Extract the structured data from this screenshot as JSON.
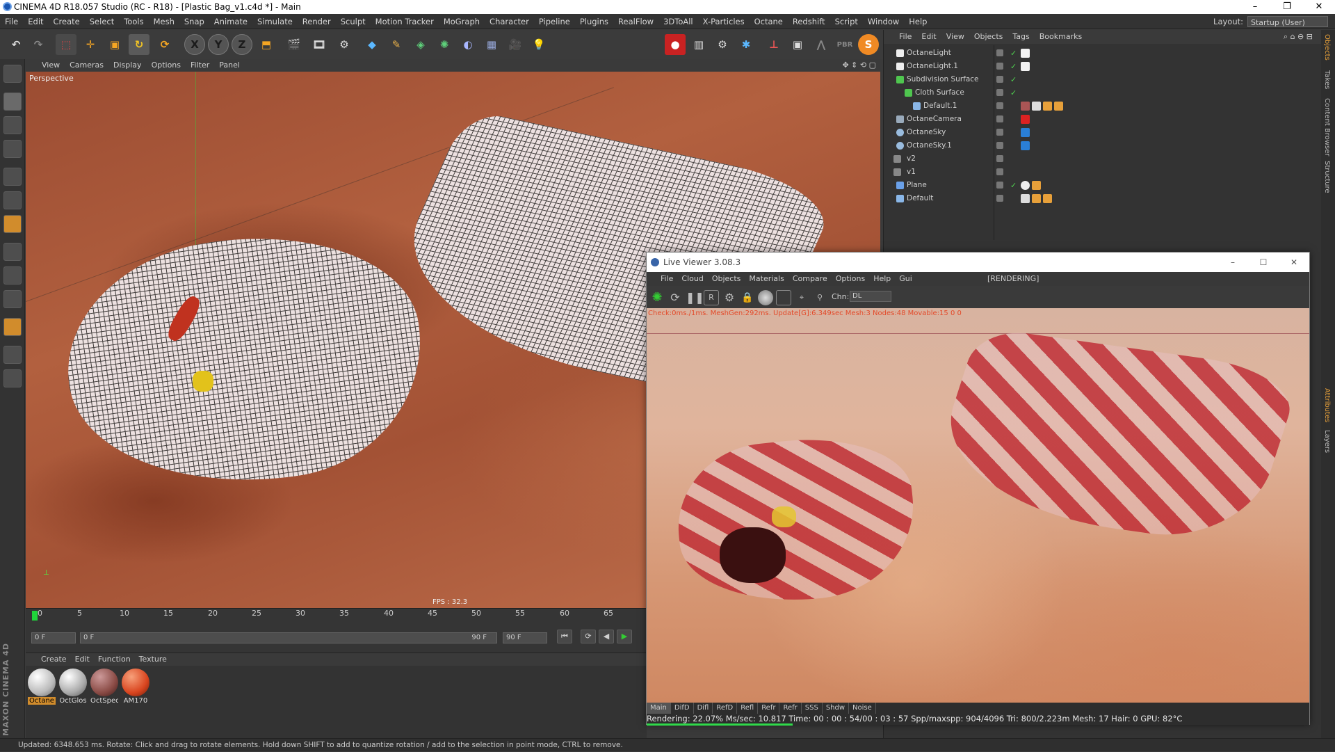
{
  "window": {
    "title": "CINEMA 4D R18.057 Studio (RC - R18) - [Plastic Bag_v1.c4d *] - Main"
  },
  "menubar": {
    "items": [
      "File",
      "Edit",
      "Create",
      "Select",
      "Tools",
      "Mesh",
      "Snap",
      "Animate",
      "Simulate",
      "Render",
      "Sculpt",
      "Motion Tracker",
      "MoGraph",
      "Character",
      "Pipeline",
      "Plugins",
      "RealFlow",
      "3DToAll",
      "X-Particles",
      "Octane",
      "Redshift",
      "Script",
      "Window",
      "Help"
    ],
    "layout_label": "Layout:",
    "layout_value": "Startup (User)"
  },
  "viewport": {
    "menu": [
      "View",
      "Cameras",
      "Display",
      "Options",
      "Filter",
      "Panel"
    ],
    "label": "Perspective",
    "fps": "FPS : 32.3"
  },
  "timeline": {
    "ticks": [
      "0",
      "5",
      "10",
      "15",
      "20",
      "25",
      "30",
      "35",
      "40",
      "45",
      "50",
      "55",
      "60",
      "65"
    ],
    "start_field": "0 F",
    "range_start": "0 F",
    "range_end": "90 F",
    "end_field": "90 F"
  },
  "materials": {
    "menu": [
      "Create",
      "Edit",
      "Function",
      "Texture"
    ],
    "items": [
      {
        "label": "Octane",
        "color": "#e8e8e8"
      },
      {
        "label": "OctGlos",
        "color": "#dcdcdc"
      },
      {
        "label": "OctSpec",
        "color": "#8a4b45"
      },
      {
        "label": "AM170",
        "color": "#d9451f"
      }
    ]
  },
  "status": {
    "text": "Updated: 6348.653 ms.    Rotate: Click and drag to rotate elements. Hold down SHIFT to add to quantize rotation / add to the selection in point mode, CTRL to remove."
  },
  "objects": {
    "menu": [
      "File",
      "Edit",
      "View",
      "Objects",
      "Tags",
      "Bookmarks"
    ],
    "rows": [
      {
        "name": "OctaneLight"
      },
      {
        "name": "OctaneLight.1"
      },
      {
        "name": "Subdivision Surface"
      },
      {
        "name": "Cloth Surface"
      },
      {
        "name": "Default.1"
      },
      {
        "name": "OctaneCamera"
      },
      {
        "name": "OctaneSky"
      },
      {
        "name": "OctaneSky.1"
      },
      {
        "name": "v2"
      },
      {
        "name": "v1"
      },
      {
        "name": "Plane"
      },
      {
        "name": "Default"
      }
    ],
    "side_tabs": [
      "Objects",
      "Takes",
      "Content Browser",
      "Structure"
    ],
    "side_tabs_lower": [
      "Attributes",
      "Layers"
    ]
  },
  "liveviewer": {
    "title": "Live Viewer 3.08.3",
    "menu": [
      "File",
      "Cloud",
      "Objects",
      "Materials",
      "Compare",
      "Options",
      "Help",
      "Gui"
    ],
    "status": "[RENDERING]",
    "chn_label": "Chn:",
    "chn_value": "DL",
    "debug": "Check:0ms./1ms. MeshGen:292ms. Update[G]:6.349sec Mesh:3 Nodes:48 Movable:15  0 0",
    "channels": [
      "Main",
      "DifD",
      "Difl",
      "RefD",
      "Refl",
      "Refr",
      "Refr",
      "SSS",
      "Shdw",
      "Noise"
    ],
    "stats": "Rendering: 22.07%  Ms/sec: 10.817   Time: 00 : 00 : 54/00 : 03 : 57    Spp/maxspp: 904/4096    Tri: 800/2.223m   Mesh: 17    Hair: 0     GPU:      82°C",
    "progress": 0.2207
  },
  "colors": {
    "accent_green": "#2fd94a",
    "title_bar": "#ffffff",
    "panel": "#333333"
  }
}
